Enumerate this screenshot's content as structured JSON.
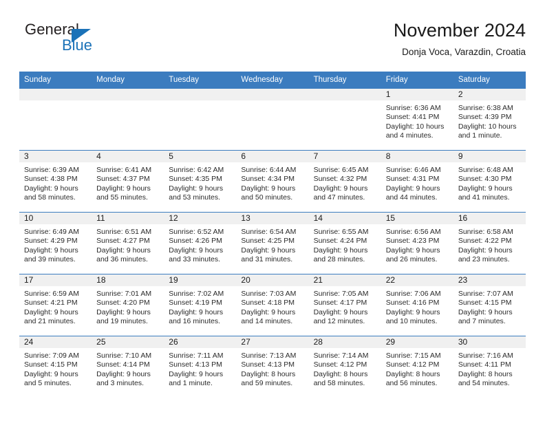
{
  "brand": {
    "name_top": "General",
    "name_bottom": "Blue",
    "triangle_color": "#1b72b8",
    "text_color": "#231f20"
  },
  "header": {
    "title": "November 2024",
    "subtitle": "Donja Voca, Varazdin, Croatia"
  },
  "theme": {
    "header_blue": "#3b7cbf",
    "daynum_band": "#f0f0f0",
    "text": "#1a1a1a"
  },
  "weekday_headers": [
    "Sunday",
    "Monday",
    "Tuesday",
    "Wednesday",
    "Thursday",
    "Friday",
    "Saturday"
  ],
  "labels": {
    "sunrise_prefix": "Sunrise:",
    "sunset_prefix": "Sunset:",
    "daylight_prefix": "Daylight:"
  },
  "weeks": [
    [
      {
        "day": "",
        "sunrise": "",
        "sunset": "",
        "daylight_line1": "",
        "daylight_line2": ""
      },
      {
        "day": "",
        "sunrise": "",
        "sunset": "",
        "daylight_line1": "",
        "daylight_line2": ""
      },
      {
        "day": "",
        "sunrise": "",
        "sunset": "",
        "daylight_line1": "",
        "daylight_line2": ""
      },
      {
        "day": "",
        "sunrise": "",
        "sunset": "",
        "daylight_line1": "",
        "daylight_line2": ""
      },
      {
        "day": "",
        "sunrise": "",
        "sunset": "",
        "daylight_line1": "",
        "daylight_line2": ""
      },
      {
        "day": "1",
        "sunrise": "Sunrise: 6:36 AM",
        "sunset": "Sunset: 4:41 PM",
        "daylight_line1": "Daylight: 10 hours",
        "daylight_line2": "and 4 minutes."
      },
      {
        "day": "2",
        "sunrise": "Sunrise: 6:38 AM",
        "sunset": "Sunset: 4:39 PM",
        "daylight_line1": "Daylight: 10 hours",
        "daylight_line2": "and 1 minute."
      }
    ],
    [
      {
        "day": "3",
        "sunrise": "Sunrise: 6:39 AM",
        "sunset": "Sunset: 4:38 PM",
        "daylight_line1": "Daylight: 9 hours",
        "daylight_line2": "and 58 minutes."
      },
      {
        "day": "4",
        "sunrise": "Sunrise: 6:41 AM",
        "sunset": "Sunset: 4:37 PM",
        "daylight_line1": "Daylight: 9 hours",
        "daylight_line2": "and 55 minutes."
      },
      {
        "day": "5",
        "sunrise": "Sunrise: 6:42 AM",
        "sunset": "Sunset: 4:35 PM",
        "daylight_line1": "Daylight: 9 hours",
        "daylight_line2": "and 53 minutes."
      },
      {
        "day": "6",
        "sunrise": "Sunrise: 6:44 AM",
        "sunset": "Sunset: 4:34 PM",
        "daylight_line1": "Daylight: 9 hours",
        "daylight_line2": "and 50 minutes."
      },
      {
        "day": "7",
        "sunrise": "Sunrise: 6:45 AM",
        "sunset": "Sunset: 4:32 PM",
        "daylight_line1": "Daylight: 9 hours",
        "daylight_line2": "and 47 minutes."
      },
      {
        "day": "8",
        "sunrise": "Sunrise: 6:46 AM",
        "sunset": "Sunset: 4:31 PM",
        "daylight_line1": "Daylight: 9 hours",
        "daylight_line2": "and 44 minutes."
      },
      {
        "day": "9",
        "sunrise": "Sunrise: 6:48 AM",
        "sunset": "Sunset: 4:30 PM",
        "daylight_line1": "Daylight: 9 hours",
        "daylight_line2": "and 41 minutes."
      }
    ],
    [
      {
        "day": "10",
        "sunrise": "Sunrise: 6:49 AM",
        "sunset": "Sunset: 4:29 PM",
        "daylight_line1": "Daylight: 9 hours",
        "daylight_line2": "and 39 minutes."
      },
      {
        "day": "11",
        "sunrise": "Sunrise: 6:51 AM",
        "sunset": "Sunset: 4:27 PM",
        "daylight_line1": "Daylight: 9 hours",
        "daylight_line2": "and 36 minutes."
      },
      {
        "day": "12",
        "sunrise": "Sunrise: 6:52 AM",
        "sunset": "Sunset: 4:26 PM",
        "daylight_line1": "Daylight: 9 hours",
        "daylight_line2": "and 33 minutes."
      },
      {
        "day": "13",
        "sunrise": "Sunrise: 6:54 AM",
        "sunset": "Sunset: 4:25 PM",
        "daylight_line1": "Daylight: 9 hours",
        "daylight_line2": "and 31 minutes."
      },
      {
        "day": "14",
        "sunrise": "Sunrise: 6:55 AM",
        "sunset": "Sunset: 4:24 PM",
        "daylight_line1": "Daylight: 9 hours",
        "daylight_line2": "and 28 minutes."
      },
      {
        "day": "15",
        "sunrise": "Sunrise: 6:56 AM",
        "sunset": "Sunset: 4:23 PM",
        "daylight_line1": "Daylight: 9 hours",
        "daylight_line2": "and 26 minutes."
      },
      {
        "day": "16",
        "sunrise": "Sunrise: 6:58 AM",
        "sunset": "Sunset: 4:22 PM",
        "daylight_line1": "Daylight: 9 hours",
        "daylight_line2": "and 23 minutes."
      }
    ],
    [
      {
        "day": "17",
        "sunrise": "Sunrise: 6:59 AM",
        "sunset": "Sunset: 4:21 PM",
        "daylight_line1": "Daylight: 9 hours",
        "daylight_line2": "and 21 minutes."
      },
      {
        "day": "18",
        "sunrise": "Sunrise: 7:01 AM",
        "sunset": "Sunset: 4:20 PM",
        "daylight_line1": "Daylight: 9 hours",
        "daylight_line2": "and 19 minutes."
      },
      {
        "day": "19",
        "sunrise": "Sunrise: 7:02 AM",
        "sunset": "Sunset: 4:19 PM",
        "daylight_line1": "Daylight: 9 hours",
        "daylight_line2": "and 16 minutes."
      },
      {
        "day": "20",
        "sunrise": "Sunrise: 7:03 AM",
        "sunset": "Sunset: 4:18 PM",
        "daylight_line1": "Daylight: 9 hours",
        "daylight_line2": "and 14 minutes."
      },
      {
        "day": "21",
        "sunrise": "Sunrise: 7:05 AM",
        "sunset": "Sunset: 4:17 PM",
        "daylight_line1": "Daylight: 9 hours",
        "daylight_line2": "and 12 minutes."
      },
      {
        "day": "22",
        "sunrise": "Sunrise: 7:06 AM",
        "sunset": "Sunset: 4:16 PM",
        "daylight_line1": "Daylight: 9 hours",
        "daylight_line2": "and 10 minutes."
      },
      {
        "day": "23",
        "sunrise": "Sunrise: 7:07 AM",
        "sunset": "Sunset: 4:15 PM",
        "daylight_line1": "Daylight: 9 hours",
        "daylight_line2": "and 7 minutes."
      }
    ],
    [
      {
        "day": "24",
        "sunrise": "Sunrise: 7:09 AM",
        "sunset": "Sunset: 4:15 PM",
        "daylight_line1": "Daylight: 9 hours",
        "daylight_line2": "and 5 minutes."
      },
      {
        "day": "25",
        "sunrise": "Sunrise: 7:10 AM",
        "sunset": "Sunset: 4:14 PM",
        "daylight_line1": "Daylight: 9 hours",
        "daylight_line2": "and 3 minutes."
      },
      {
        "day": "26",
        "sunrise": "Sunrise: 7:11 AM",
        "sunset": "Sunset: 4:13 PM",
        "daylight_line1": "Daylight: 9 hours",
        "daylight_line2": "and 1 minute."
      },
      {
        "day": "27",
        "sunrise": "Sunrise: 7:13 AM",
        "sunset": "Sunset: 4:13 PM",
        "daylight_line1": "Daylight: 8 hours",
        "daylight_line2": "and 59 minutes."
      },
      {
        "day": "28",
        "sunrise": "Sunrise: 7:14 AM",
        "sunset": "Sunset: 4:12 PM",
        "daylight_line1": "Daylight: 8 hours",
        "daylight_line2": "and 58 minutes."
      },
      {
        "day": "29",
        "sunrise": "Sunrise: 7:15 AM",
        "sunset": "Sunset: 4:12 PM",
        "daylight_line1": "Daylight: 8 hours",
        "daylight_line2": "and 56 minutes."
      },
      {
        "day": "30",
        "sunrise": "Sunrise: 7:16 AM",
        "sunset": "Sunset: 4:11 PM",
        "daylight_line1": "Daylight: 8 hours",
        "daylight_line2": "and 54 minutes."
      }
    ]
  ]
}
